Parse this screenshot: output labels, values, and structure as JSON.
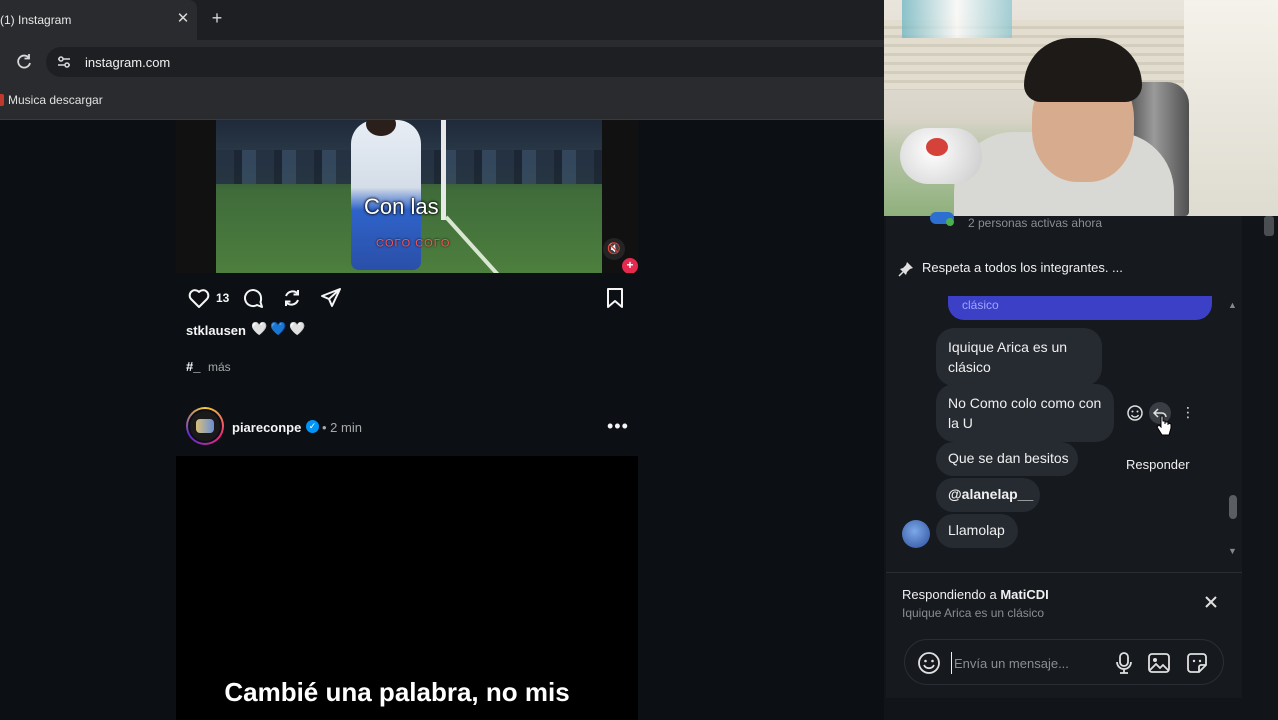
{
  "browser": {
    "tab_title": "(1) Instagram",
    "tab_close": "✕",
    "new_tab": "+",
    "url": "instagram.com",
    "bookmark_label": "Musica descargar"
  },
  "feed": {
    "post1": {
      "video_caption": "Con las",
      "video_caption_sub": "COLO COLO",
      "likes": "13",
      "author": "stklausen",
      "author_hearts": "🤍💙🤍",
      "hashtag": "#_",
      "more": "más"
    },
    "post2": {
      "author": "piareconpe",
      "time": "• 2 min",
      "video_caption": "Cambié una palabra, no mis"
    }
  },
  "chat": {
    "active_now": "2 personas activas ahora",
    "pinned": "Respeta a todos los integrantes. ...",
    "blue_bubble_text": "clásico",
    "messages": [
      {
        "text": "Iquique Arica es un clásico"
      },
      {
        "text": "No Como colo como con la U"
      },
      {
        "text": "Que se dan besitos"
      },
      {
        "text": "@alanelap__"
      },
      {
        "text": "Llamolap"
      }
    ],
    "tooltip": "Responder",
    "reply": {
      "prefix": "Respondiendo a ",
      "user": "MatiCDI",
      "quote": "Iquique Arica es un clásico"
    },
    "composer_placeholder": "Envía un mensaje..."
  },
  "colors": {
    "accent_blue": "#3c40c6",
    "like_red": "#e6294e",
    "verified_blue": "#0095f6"
  },
  "icons": [
    "reload-icon",
    "site-info-icon",
    "heart-icon",
    "comment-icon",
    "repost-icon",
    "share-icon",
    "bookmark-icon",
    "mute-icon",
    "verified-icon",
    "more-icon",
    "pin-icon",
    "react-icon",
    "reply-icon",
    "close-icon",
    "emoji-icon",
    "mic-icon",
    "image-icon",
    "sticker-icon"
  ]
}
